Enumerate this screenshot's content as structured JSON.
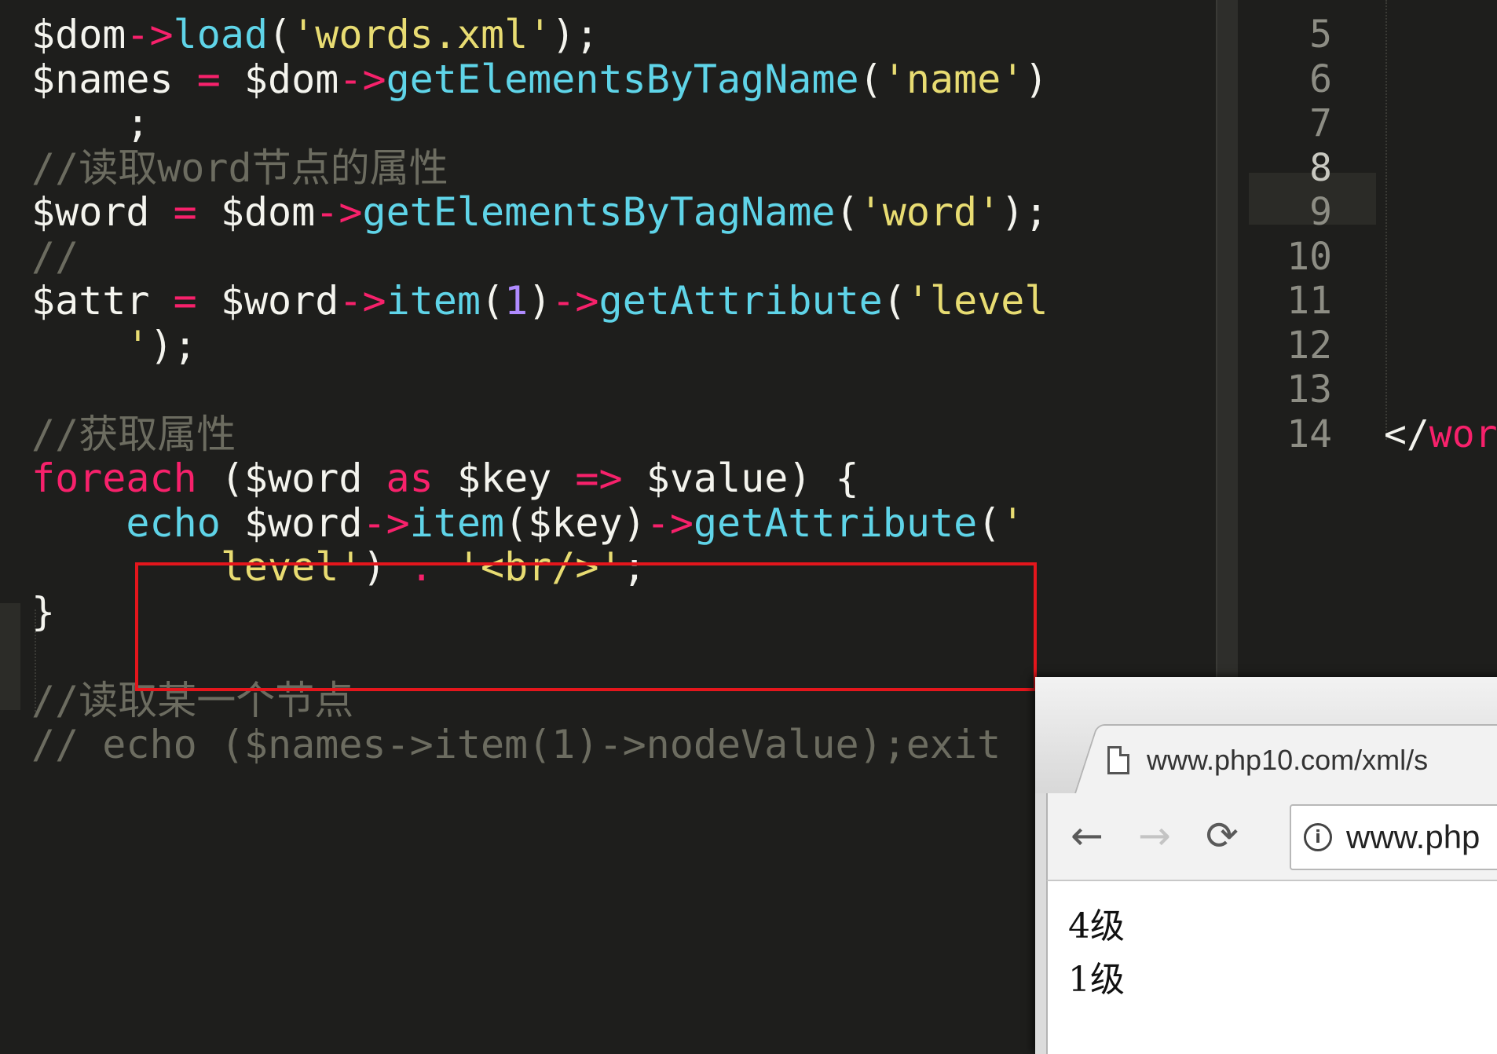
{
  "editor_left": {
    "lines": [
      {
        "parts": [
          [
            "pl",
            "$dom"
          ],
          [
            "op",
            "->"
          ],
          [
            "fn",
            "load"
          ],
          [
            "pl",
            "("
          ],
          [
            "str",
            "'words.xml'"
          ],
          [
            "pl",
            ");"
          ]
        ]
      },
      {
        "parts": [
          [
            "pl",
            "$names "
          ],
          [
            "op",
            "="
          ],
          [
            "pl",
            " $dom"
          ],
          [
            "op",
            "->"
          ],
          [
            "fn",
            "getElementsByTagName"
          ],
          [
            "pl",
            "("
          ],
          [
            "str",
            "'name'"
          ],
          [
            "pl",
            ")"
          ]
        ]
      },
      {
        "parts": [
          [
            "pl",
            "    ;"
          ]
        ]
      },
      {
        "parts": [
          [
            "cm",
            "//读取word节点的属性"
          ]
        ]
      },
      {
        "parts": [
          [
            "pl",
            "$word "
          ],
          [
            "op",
            "="
          ],
          [
            "pl",
            " $dom"
          ],
          [
            "op",
            "->"
          ],
          [
            "fn",
            "getElementsByTagName"
          ],
          [
            "pl",
            "("
          ],
          [
            "str",
            "'word'"
          ],
          [
            "pl",
            ");"
          ]
        ]
      },
      {
        "parts": [
          [
            "cm",
            "//"
          ]
        ]
      },
      {
        "parts": [
          [
            "pl",
            "$attr "
          ],
          [
            "op",
            "="
          ],
          [
            "pl",
            " $word"
          ],
          [
            "op",
            "->"
          ],
          [
            "fn",
            "item"
          ],
          [
            "pl",
            "("
          ],
          [
            "num",
            "1"
          ],
          [
            "pl",
            ")"
          ],
          [
            "op",
            "->"
          ],
          [
            "fn",
            "getAttribute"
          ],
          [
            "pl",
            "("
          ],
          [
            "str",
            "'level"
          ]
        ]
      },
      {
        "parts": [
          [
            "str",
            "    '"
          ],
          [
            "pl",
            ");"
          ]
        ]
      },
      {
        "parts": []
      },
      {
        "parts": [
          [
            "cm",
            "//获取属性"
          ]
        ]
      },
      {
        "parts": [
          [
            "kw",
            "foreach"
          ],
          [
            "pl",
            " ($word "
          ],
          [
            "kw",
            "as"
          ],
          [
            "pl",
            " $key "
          ],
          [
            "op",
            "=>"
          ],
          [
            "pl",
            " $value) {"
          ]
        ]
      },
      {
        "parts": [
          [
            "pl",
            "    "
          ],
          [
            "fn",
            "echo"
          ],
          [
            "pl",
            " $word"
          ],
          [
            "op",
            "->"
          ],
          [
            "fn",
            "item"
          ],
          [
            "pl",
            "($key)"
          ],
          [
            "op",
            "->"
          ],
          [
            "fn",
            "getAttribute"
          ],
          [
            "pl",
            "("
          ],
          [
            "str",
            "'"
          ]
        ]
      },
      {
        "parts": [
          [
            "str",
            "        level'"
          ],
          [
            "pl",
            ") "
          ],
          [
            "op",
            "."
          ],
          [
            "pl",
            " "
          ],
          [
            "str",
            "'<br/>'"
          ],
          [
            "pl",
            ";"
          ]
        ]
      },
      {
        "parts": [
          [
            "pl",
            "}"
          ]
        ]
      },
      {
        "parts": []
      },
      {
        "parts": [
          [
            "cm",
            "//读取某一个节点"
          ]
        ]
      },
      {
        "parts": [
          [
            "cm",
            "// echo ($names->item(1)->nodeValue);exit"
          ]
        ]
      }
    ]
  },
  "editor_right": {
    "line_numbers": [
      "5",
      "6",
      "7",
      "8",
      "9",
      "10",
      "11",
      "12",
      "13",
      "14"
    ],
    "current_line": "8",
    "code_fragments": [
      {
        "row": 2,
        "text": "<"
      },
      {
        "row": 3,
        "text": "<"
      },
      {
        "row": 7,
        "text": "<"
      },
      {
        "row": 9,
        "text": "</wor"
      }
    ]
  },
  "browser": {
    "tab_title": "www.php10.com/xml/s",
    "back_icon": "←",
    "forward_icon": "→",
    "reload_icon": "⟳",
    "address_text": "www.php",
    "output_lines": [
      "4级",
      "1级"
    ]
  }
}
